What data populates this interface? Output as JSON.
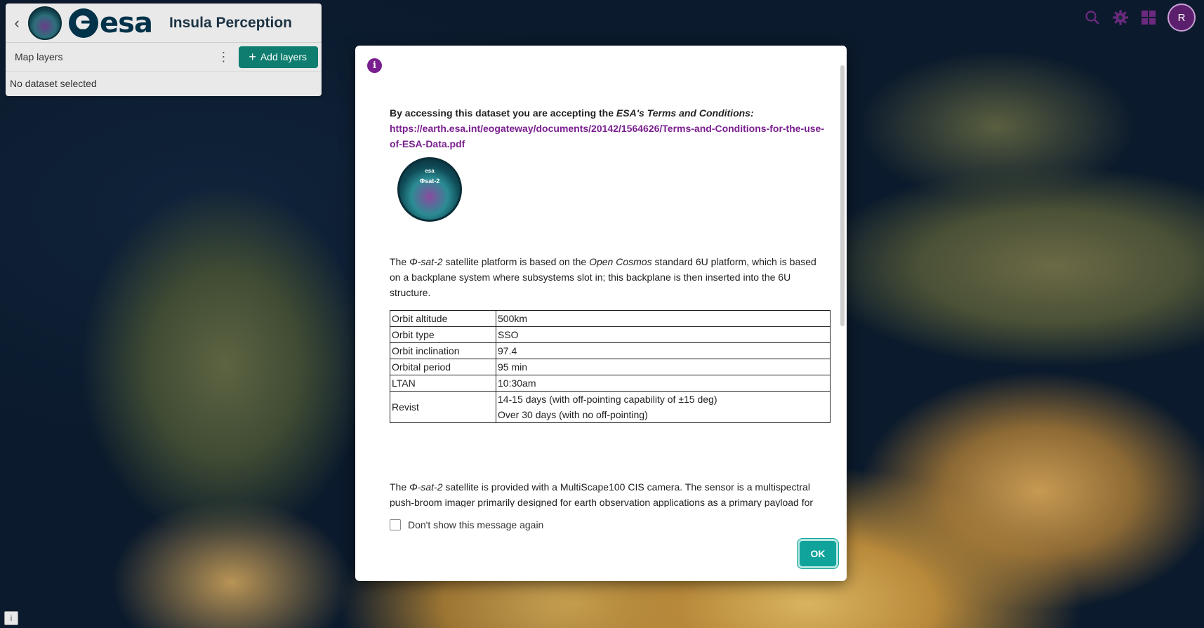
{
  "app": {
    "org_wordmark": "esa",
    "title": "Insula Perception"
  },
  "panel": {
    "layers_label": "Map layers",
    "add_layers_label": "Add layers",
    "no_dataset": "No dataset selected"
  },
  "header_icons": [
    "search-icon",
    "gear-icon",
    "apps-grid-icon"
  ],
  "user": {
    "initial": "R"
  },
  "colors": {
    "accent": "#0f7d6f",
    "ok": "#10a39b",
    "brand_purple": "#7a1f8f",
    "esa_navy": "#003249"
  },
  "modal": {
    "terms_prefix": "By accessing this dataset you are accepting the ",
    "terms_italic": "ESA's Terms and Conditions:",
    "terms_link": "https://earth.esa.int/eogateway/documents/20142/1564626/Terms-and-Conditions-for-the-use-of-ESA-Data.pdf",
    "logo_text_top": "esa",
    "logo_text": "Φsat-2",
    "para1": {
      "a": "The ",
      "b": "Φ-sat-2",
      "c": " satellite platform is based on the ",
      "d": "Open Cosmos",
      "e": " standard 6U platform, which is based on a backplane system where subsystems slot in; this backplane is then inserted into the 6U structure."
    },
    "table": [
      {
        "k": "Orbit altitude",
        "v": "500km"
      },
      {
        "k": "Orbit type",
        "v": "SSO"
      },
      {
        "k": "Orbit inclination",
        "v": "97.4"
      },
      {
        "k": "Orbital period",
        "v": "95 min"
      },
      {
        "k": "LTAN",
        "v": "10:30am"
      },
      {
        "k": "Revist",
        "v": "14-15 days (with off-pointing capability of ±15 deg)",
        "v2": "Over 30 days (with no off-pointing)"
      }
    ],
    "para2": {
      "a": "The ",
      "b": "Φ-sat-2",
      "c": " satellite is provided with a MultiScape100 CIS camera. The sensor is a multispectral push-broom imager primarily designed for earth observation applications as a primary payload for"
    },
    "dont_show": "Don't show this message again",
    "ok_label": "OK"
  },
  "map_info": "i"
}
